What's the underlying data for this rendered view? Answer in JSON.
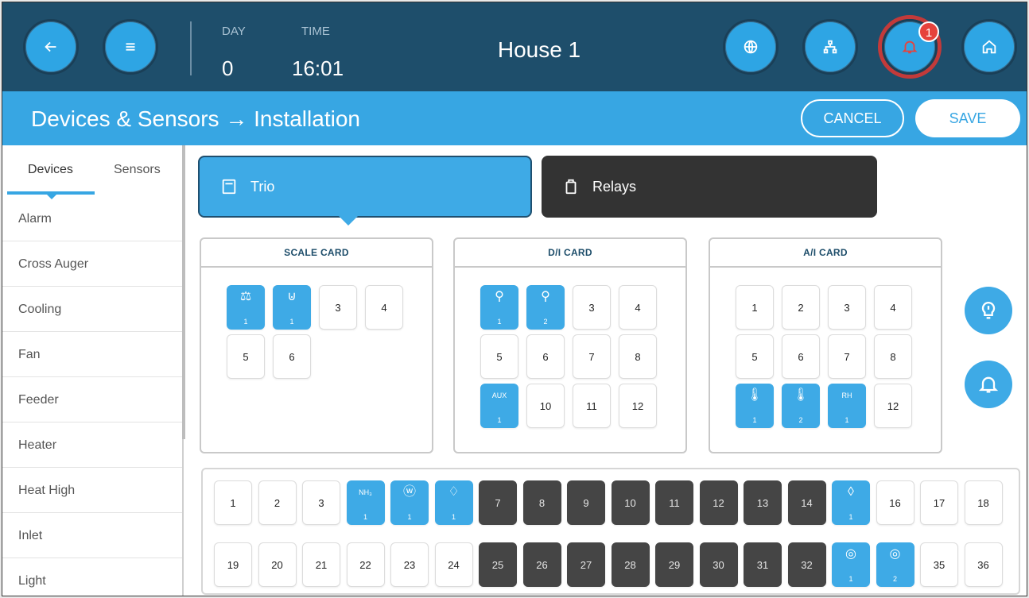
{
  "header": {
    "day_label": "DAY",
    "day_value": "0",
    "time_label": "TIME",
    "time_value": "16:01",
    "house": "House 1",
    "alarm_count": "1"
  },
  "subheader": {
    "title": "Devices & Sensors → Installation",
    "cancel": "CANCEL",
    "save": "SAVE"
  },
  "sidebar": {
    "tabs": [
      "Devices",
      "Sensors"
    ],
    "items": [
      "Alarm",
      "Cross Auger",
      "Cooling",
      "Fan",
      "Feeder",
      "Heater",
      "Heat High",
      "Inlet",
      "Light"
    ]
  },
  "modules": {
    "trio": "Trio",
    "relays": "Relays"
  },
  "cards": {
    "scale": {
      "title": "SCALE CARD"
    },
    "di": {
      "title": "D/I CARD"
    },
    "ai": {
      "title": "A/I CARD"
    }
  },
  "slots": {
    "scale": [
      {
        "kind": "on",
        "icon": "bird-scale-icon",
        "glyph": "⚖",
        "sub": "1"
      },
      {
        "kind": "on",
        "icon": "feed-scale-icon",
        "glyph": "⊍",
        "sub": "1"
      },
      {
        "kind": "num",
        "label": "3"
      },
      {
        "kind": "num",
        "label": "4"
      },
      {
        "kind": "num",
        "label": "5"
      },
      {
        "kind": "num",
        "label": "6"
      }
    ],
    "di": [
      {
        "kind": "on",
        "icon": "water-meter-icon",
        "glyph": "⚲",
        "sub": "1"
      },
      {
        "kind": "on",
        "icon": "water-meter-icon",
        "glyph": "⚲",
        "sub": "2"
      },
      {
        "kind": "num",
        "label": "3"
      },
      {
        "kind": "num",
        "label": "4"
      },
      {
        "kind": "num",
        "label": "5"
      },
      {
        "kind": "num",
        "label": "6"
      },
      {
        "kind": "num",
        "label": "7"
      },
      {
        "kind": "num",
        "label": "8"
      },
      {
        "kind": "on",
        "text": "AUX",
        "sub": "1"
      },
      {
        "kind": "num",
        "label": "10"
      },
      {
        "kind": "num",
        "label": "11"
      },
      {
        "kind": "num",
        "label": "12"
      }
    ],
    "ai": [
      {
        "kind": "num",
        "label": "1"
      },
      {
        "kind": "num",
        "label": "2"
      },
      {
        "kind": "num",
        "label": "3"
      },
      {
        "kind": "num",
        "label": "4"
      },
      {
        "kind": "num",
        "label": "5"
      },
      {
        "kind": "num",
        "label": "6"
      },
      {
        "kind": "num",
        "label": "7"
      },
      {
        "kind": "num",
        "label": "8"
      },
      {
        "kind": "on",
        "icon": "thermometer-icon",
        "glyph": "🌡",
        "sub": "1"
      },
      {
        "kind": "on",
        "icon": "thermometer-icon",
        "glyph": "🌡",
        "sub": "2"
      },
      {
        "kind": "on",
        "text": "RH",
        "sub": "1"
      },
      {
        "kind": "num",
        "label": "12"
      }
    ],
    "relays": [
      {
        "kind": "num",
        "label": "1"
      },
      {
        "kind": "num",
        "label": "2"
      },
      {
        "kind": "num",
        "label": "3"
      },
      {
        "kind": "on",
        "text": "NH₃",
        "sub": "1"
      },
      {
        "kind": "on",
        "icon": "humidity-sensor-icon",
        "glyph": "ⓦ",
        "sub": "1"
      },
      {
        "kind": "on",
        "icon": "light-sensor-icon",
        "glyph": "♢",
        "sub": "1"
      },
      {
        "kind": "dark",
        "label": "7"
      },
      {
        "kind": "dark",
        "label": "8"
      },
      {
        "kind": "dark",
        "label": "9"
      },
      {
        "kind": "dark",
        "label": "10"
      },
      {
        "kind": "dark",
        "label": "11"
      },
      {
        "kind": "dark",
        "label": "12"
      },
      {
        "kind": "dark",
        "label": "13"
      },
      {
        "kind": "dark",
        "label": "14"
      },
      {
        "kind": "on",
        "icon": "water-drop-icon",
        "glyph": "◊",
        "sub": "1"
      },
      {
        "kind": "num",
        "label": "16"
      },
      {
        "kind": "num",
        "label": "17"
      },
      {
        "kind": "num",
        "label": "18"
      },
      {
        "kind": "num",
        "label": "19"
      },
      {
        "kind": "num",
        "label": "20"
      },
      {
        "kind": "num",
        "label": "21"
      },
      {
        "kind": "num",
        "label": "22"
      },
      {
        "kind": "num",
        "label": "23"
      },
      {
        "kind": "num",
        "label": "24"
      },
      {
        "kind": "dark",
        "label": "25"
      },
      {
        "kind": "dark",
        "label": "26"
      },
      {
        "kind": "dark",
        "label": "27"
      },
      {
        "kind": "dark",
        "label": "28"
      },
      {
        "kind": "dark",
        "label": "29"
      },
      {
        "kind": "dark",
        "label": "30"
      },
      {
        "kind": "dark",
        "label": "31"
      },
      {
        "kind": "dark",
        "label": "32"
      },
      {
        "kind": "on",
        "icon": "pressure-sensor-icon",
        "glyph": "◎",
        "sub": "1"
      },
      {
        "kind": "on",
        "icon": "pressure-sensor-icon",
        "glyph": "◎",
        "sub": "2"
      },
      {
        "kind": "num",
        "label": "35"
      },
      {
        "kind": "num",
        "label": "36"
      }
    ]
  }
}
